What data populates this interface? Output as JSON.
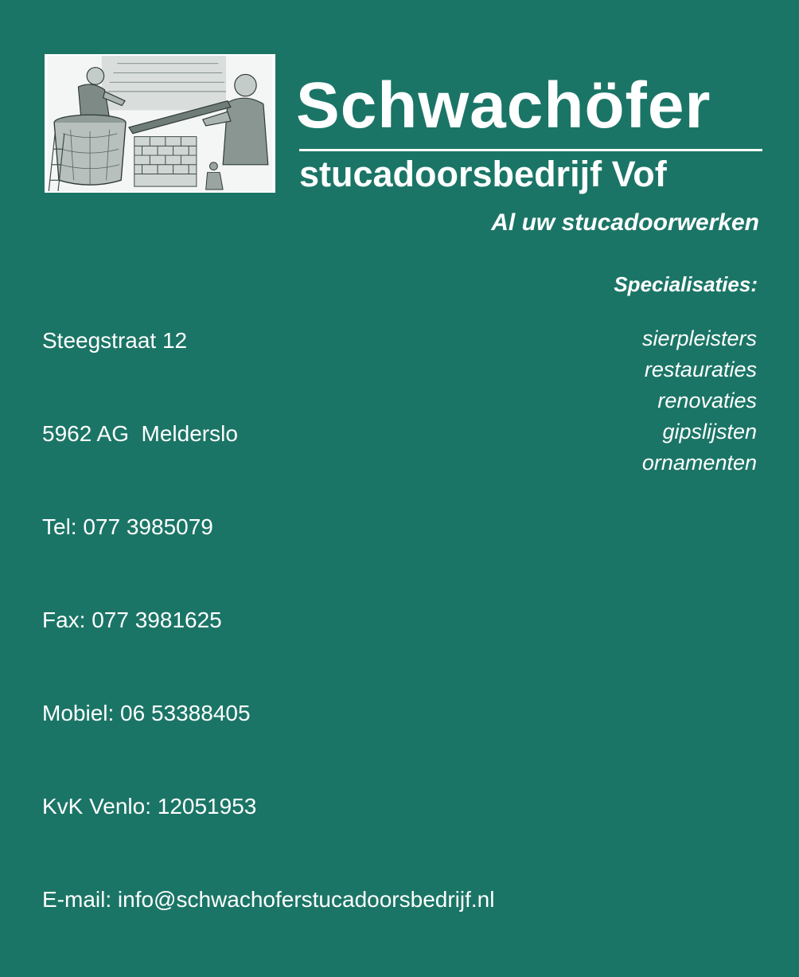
{
  "header": {
    "company_name": "Schwachöfer",
    "company_subtitle": "stucadoorsbedrijf Vof",
    "tagline": "Al uw stucadoorwerken"
  },
  "contact": {
    "street": "Steegstraat 12",
    "postal_city": "5962 AG  Melderslo",
    "phone": "Tel: 077 3985079",
    "fax": "Fax: 077 3981625",
    "mobile": "Mobiel: 06 53388405",
    "kvk": "KvK Venlo: 12051953",
    "email": "E-mail: info@schwachoferstucadoorsbedrijf.nl"
  },
  "specialisations": {
    "heading": "Specialisaties:",
    "items": [
      "sierpleisters",
      "restauraties",
      "renovaties",
      "gipslijsten",
      "ornamenten"
    ]
  },
  "colors": {
    "background": "#1b7566",
    "text": "#ffffff",
    "illustration_ink": "#3c4a46"
  },
  "icons": {
    "illustration": "plasterers-at-work-illustration"
  }
}
